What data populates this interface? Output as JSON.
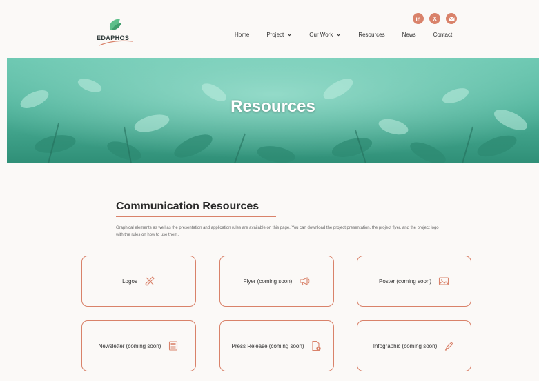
{
  "brand": {
    "name": "EDAPHOS",
    "colors": {
      "accent": "#d9826a",
      "leaf": "#5dbf8a",
      "hero": "#4fb39b"
    }
  },
  "social": [
    {
      "label": "in",
      "icon": "linkedin-icon"
    },
    {
      "label": "X",
      "icon": "x-icon"
    },
    {
      "label": "✉",
      "icon": "email-icon"
    }
  ],
  "nav": {
    "items": [
      {
        "label": "Home",
        "dropdown": false
      },
      {
        "label": "Project",
        "dropdown": true
      },
      {
        "label": "Our Work",
        "dropdown": true
      },
      {
        "label": "Resources",
        "dropdown": false
      },
      {
        "label": "News",
        "dropdown": false
      },
      {
        "label": "Contact",
        "dropdown": false
      }
    ]
  },
  "hero": {
    "title": "Resources"
  },
  "section": {
    "title": "Communication Resources",
    "description": "Graphical elements as well as the presentation and application rules are available on this page. You can download the project presentation, the project flyer, and the project logo with the rules on how to use them."
  },
  "cards": [
    {
      "label": "Logos",
      "icon": "pencil-ruler-icon"
    },
    {
      "label": "Flyer (coming soon)",
      "icon": "megaphone-icon"
    },
    {
      "label": "Poster (coming soon)",
      "icon": "image-icon"
    },
    {
      "label": "Newsletter (coming soon)",
      "icon": "newspaper-icon"
    },
    {
      "label": "Press Release (coming soon)",
      "icon": "file-info-icon"
    },
    {
      "label": "Infographic (coming soon)",
      "icon": "pen-icon"
    }
  ]
}
